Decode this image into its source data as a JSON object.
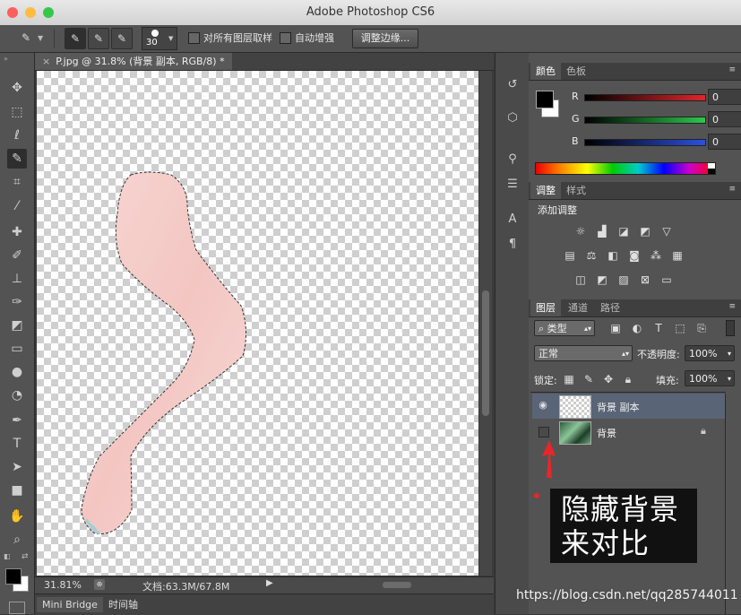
{
  "window": {
    "title": "Adobe Photoshop CS6",
    "traffic_lights": {
      "close": "#fc605c",
      "minimize": "#fdbc40",
      "zoom": "#34c84a"
    }
  },
  "options_bar": {
    "brush_size": "30",
    "sample_all_layers_label": "对所有图层取样",
    "sample_all_layers_checked": false,
    "auto_enhance_label": "自动增强",
    "auto_enhance_checked": false,
    "refine_edge_label": "调整边缘..."
  },
  "tools": [
    "move-tool-icon",
    "marquee-tool-icon",
    "lasso-tool-icon",
    "quick-selection-tool-icon",
    "crop-tool-icon",
    "eyedropper-tool-icon",
    "spot-healing-tool-icon",
    "brush-tool-icon",
    "clone-stamp-tool-icon",
    "history-brush-tool-icon",
    "eraser-tool-icon",
    "gradient-tool-icon",
    "blur-tool-icon",
    "dodge-tool-icon",
    "pen-tool-icon",
    "type-tool-icon",
    "path-selection-tool-icon",
    "rectangle-tool-icon",
    "hand-tool-icon",
    "zoom-tool-icon"
  ],
  "document": {
    "tab_title": "P.jpg @ 31.8% (背景 副本, RGB/8) *",
    "zoom": "31.81%",
    "doc_size": "文档:63.3M/67.8M"
  },
  "bottom_tabs": [
    "Mini Bridge",
    "时间轴"
  ],
  "color_panel": {
    "tabs": [
      "颜色",
      "色板"
    ],
    "channels": [
      {
        "label": "R",
        "value": "0",
        "color": "#e0262a"
      },
      {
        "label": "G",
        "value": "0",
        "color": "#2cc84c"
      },
      {
        "label": "B",
        "value": "0",
        "color": "#2c50e0"
      }
    ],
    "foreground": "#000000",
    "background": "#ffffff"
  },
  "adjustments_panel": {
    "tabs": [
      "调整",
      "样式"
    ],
    "heading": "添加调整"
  },
  "layers_panel": {
    "tabs": [
      "图层",
      "通道",
      "路径"
    ],
    "filter_kind": "类型",
    "blend_mode": "正常",
    "opacity_label": "不透明度:",
    "opacity": "100%",
    "lock_label": "锁定:",
    "fill_label": "填充:",
    "fill": "100%",
    "layers": [
      {
        "name": "背景 副本",
        "visible": true,
        "selected": true,
        "locked": false
      },
      {
        "name": "背景",
        "visible": false,
        "selected": false,
        "locked": true
      }
    ]
  },
  "annotation": {
    "line1": "隐藏背景",
    "line2": "来对比",
    "arrow_color": "#e8262a"
  },
  "watermark": "https://blog.csdn.net/qq285744011"
}
